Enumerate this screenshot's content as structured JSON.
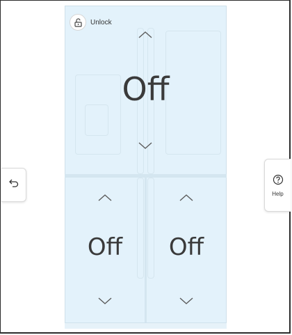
{
  "unlock": {
    "label": "Unlock",
    "icon": "unlock-icon"
  },
  "zones": {
    "top": {
      "temperature": "Off"
    },
    "bottom_left": {
      "temperature": "Off"
    },
    "bottom_right": {
      "temperature": "Off"
    }
  },
  "help": {
    "label": "Help",
    "icon": "help-icon"
  },
  "back": {
    "icon": "back-arrow-icon"
  },
  "colors": {
    "panel": "#e3f2fb",
    "text": "#3a3a3a",
    "outline": "#d4e6f0"
  }
}
